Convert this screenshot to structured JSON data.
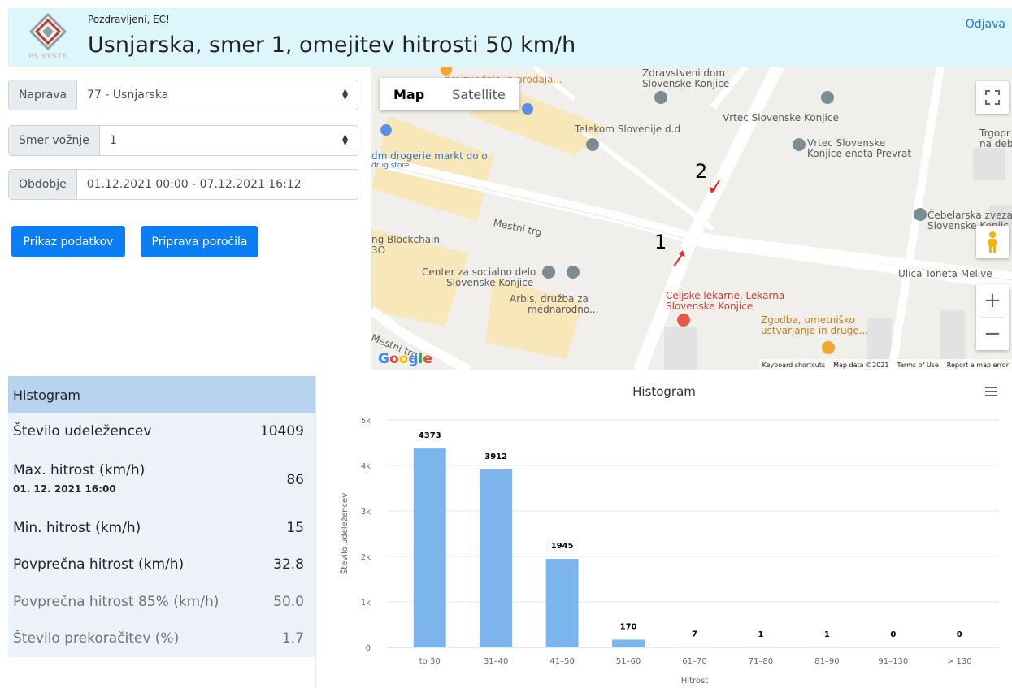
{
  "header": {
    "greeting": "Pozdravljeni, EC!",
    "title": "Usnjarska, smer 1, omejitev hitrosti 50 km/h",
    "logout_label": "Odjava",
    "logo_text": "COPS SYSTEMS"
  },
  "form": {
    "device_label": "Naprava",
    "device_value": "77 - Usnjarska",
    "direction_label": "Smer vožnje",
    "direction_value": "1",
    "period_label": "Obdobje",
    "period_value": "01.12.2021 00:00 - 07.12.2021 16:12",
    "show_button": "Prikaz podatkov",
    "report_button": "Priprava poročila"
  },
  "map": {
    "tab_map": "Map",
    "tab_satellite": "Satellite",
    "zoom_in": "+",
    "zoom_out": "−",
    "google": "Google",
    "footer": {
      "shortcuts": "Keyboard shortcuts",
      "data": "Map data ©2021",
      "terms": "Terms of Use",
      "report": "Report a map error"
    },
    "labels": {
      "proizvodnja": "proizvodnja in prodaja...",
      "zdravstveni": "Zdravstveni dom",
      "zdravstveni2": "Slovenske Konjice",
      "telekom": "Telekom Slovenije d.d",
      "vrtec": "Vrtec Slovenske Konjice",
      "vrtec_enota1": "Vrtec Slovenske",
      "vrtec_enota2": "Konjice enota Prevrat",
      "dm1": "dm drogerie markt do o",
      "dm2": "drug store",
      "mestni": "Mestni trg",
      "mestni2": "Mestni trg",
      "blockchain1": "ng Blockchain",
      "blockchain2": "3O",
      "center1": "Center za socialno delo",
      "center2": "Slovenske Konjice",
      "arbis1": "Arbis, družba za",
      "arbis2": "mednarodno...",
      "celjske1": "Celjske lekarne, Lekarna",
      "celjske2": "Slovenske Konjice",
      "zgodba1": "Zgodba, umetniško",
      "zgodba2": "ustvarjanje in druge...",
      "cebelarska1": "Čebelarska zveza",
      "cebelarska2": "Slovenske Konjic",
      "toneta": "Ulica Toneta Melive",
      "toneta_vert": "Ulica Toneta Meli",
      "trgopr1": "Trgopr",
      "trgopr2": "na deb",
      "marker1": "1",
      "marker2": "2"
    }
  },
  "stats": {
    "heading": "Histogram",
    "rows": [
      {
        "label": "Število udeležencev",
        "value": "10409"
      },
      {
        "label": "Max. hitrost (km/h)",
        "value": "86",
        "sub": "01. 12. 2021 16:00"
      },
      {
        "label": "Min. hitrost (km/h)",
        "value": "15"
      },
      {
        "label": "Povprečna hitrost (km/h)",
        "value": "32.8"
      },
      {
        "label": "Povprečna hitrost 85% (km/h)",
        "value": "50.0"
      },
      {
        "label": "Število prekoračitev (%)",
        "value": "1.7"
      }
    ]
  },
  "chart_data": {
    "type": "bar",
    "title": "Histogram",
    "xlabel": "Hitrost",
    "ylabel": "Število udeležencev",
    "categories": [
      "to 30",
      "31–40",
      "41–50",
      "51–60",
      "61–70",
      "71–80",
      "81–90",
      "91–130",
      "> 130"
    ],
    "values": [
      4373,
      3912,
      1945,
      170,
      7,
      1,
      1,
      0,
      0
    ],
    "ylim": [
      0,
      5000
    ],
    "yticks": [
      "0",
      "1k",
      "2k",
      "3k",
      "4k",
      "5k"
    ],
    "grid": true,
    "bar_color": "#7cb5ec"
  }
}
